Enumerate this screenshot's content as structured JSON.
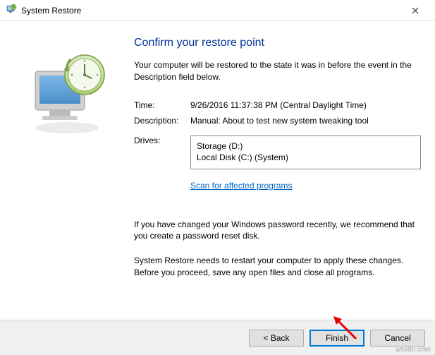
{
  "window": {
    "title": "System Restore"
  },
  "heading": "Confirm your restore point",
  "intro": "Your computer will be restored to the state it was in before the event in the Description field below.",
  "fields": {
    "time_label": "Time:",
    "time_value": "9/26/2016 11:37:38 PM (Central Daylight Time)",
    "description_label": "Description:",
    "description_value": "Manual: About to test new system tweaking tool",
    "drives_label": "Drives:",
    "drives": [
      "Storage (D:)",
      "Local Disk (C:) (System)"
    ]
  },
  "scan_link": "Scan for affected programs",
  "password_note": "If you have changed your Windows password recently, we recommend that you create a password reset disk.",
  "restart_note": "System Restore needs to restart your computer to apply these changes. Before you proceed, save any open files and close all programs.",
  "buttons": {
    "back": "< Back",
    "finish": "Finish",
    "cancel": "Cancel"
  },
  "watermark": "wsxdn.com"
}
